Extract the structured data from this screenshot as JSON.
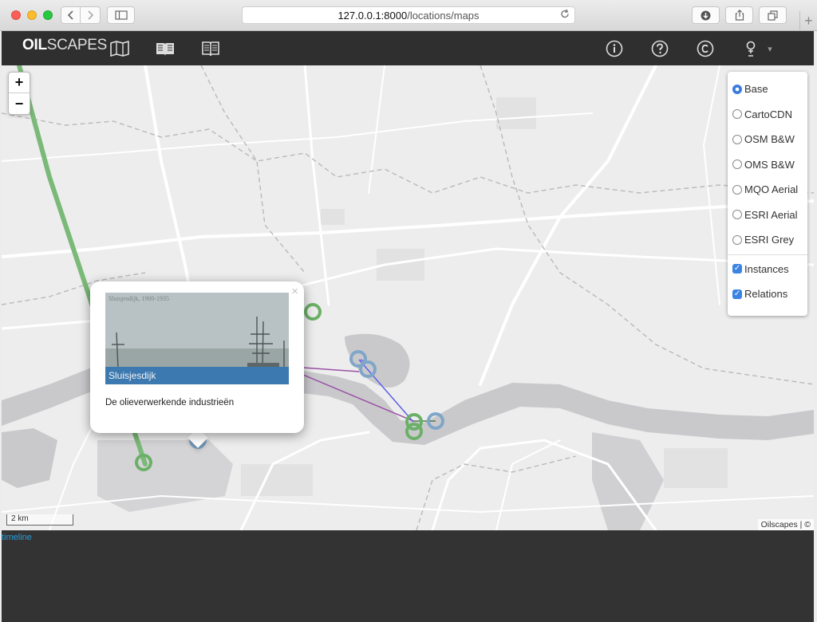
{
  "browser": {
    "url_host": "127.0.0.1:8000",
    "url_path": "/locations/maps",
    "back_icon": "chevron-left",
    "forward_icon": "chevron-right",
    "sidebar_icon": "sidebar",
    "reload_icon": "reload",
    "download_icon": "download",
    "share_icon": "share",
    "tabs_icon": "tabs",
    "new_tab_label": "+"
  },
  "navbar": {
    "brand_bold": "OIL",
    "brand_light": "SCAPES",
    "icons": [
      "map-icon",
      "book-open-icon",
      "book-icon",
      "info-icon",
      "help-icon",
      "copyright-icon",
      "user-icon"
    ],
    "dropdown_caret": "▾"
  },
  "map": {
    "zoom_in": "+",
    "zoom_out": "−",
    "layers": [
      {
        "label": "Base",
        "type": "radio",
        "checked": true
      },
      {
        "label": "CartoCDN",
        "type": "radio",
        "checked": false
      },
      {
        "label": "OSM B&W",
        "type": "radio",
        "checked": false
      },
      {
        "label": "OMS B&W",
        "type": "radio",
        "checked": false
      },
      {
        "label": "MQO Aerial",
        "type": "radio",
        "checked": false
      },
      {
        "label": "ESRI Aerial",
        "type": "radio",
        "checked": false
      },
      {
        "label": "ESRI Grey",
        "type": "radio",
        "checked": false
      }
    ],
    "overlays": [
      {
        "label": "Instances",
        "checked": true
      },
      {
        "label": "Relations",
        "checked": true
      }
    ],
    "popup": {
      "close": "×",
      "photo_top_caption": "Sluisjesdijk, 1900-1935",
      "photo_caption": "Sluisjesdijk",
      "text": "De olieverwerkende industrieën"
    },
    "scale_label": "2 km",
    "attribution": "Oilscapes | ©"
  },
  "timeline": {
    "label": "timeline"
  },
  "colors": {
    "navbar": "#2f2f2f",
    "green_marker": "#6bb067",
    "blue_marker": "#7fa6c9",
    "relation_purple": "#9a52a6",
    "relation_blue": "#5b5fe8",
    "link": "#2b9bd9"
  }
}
